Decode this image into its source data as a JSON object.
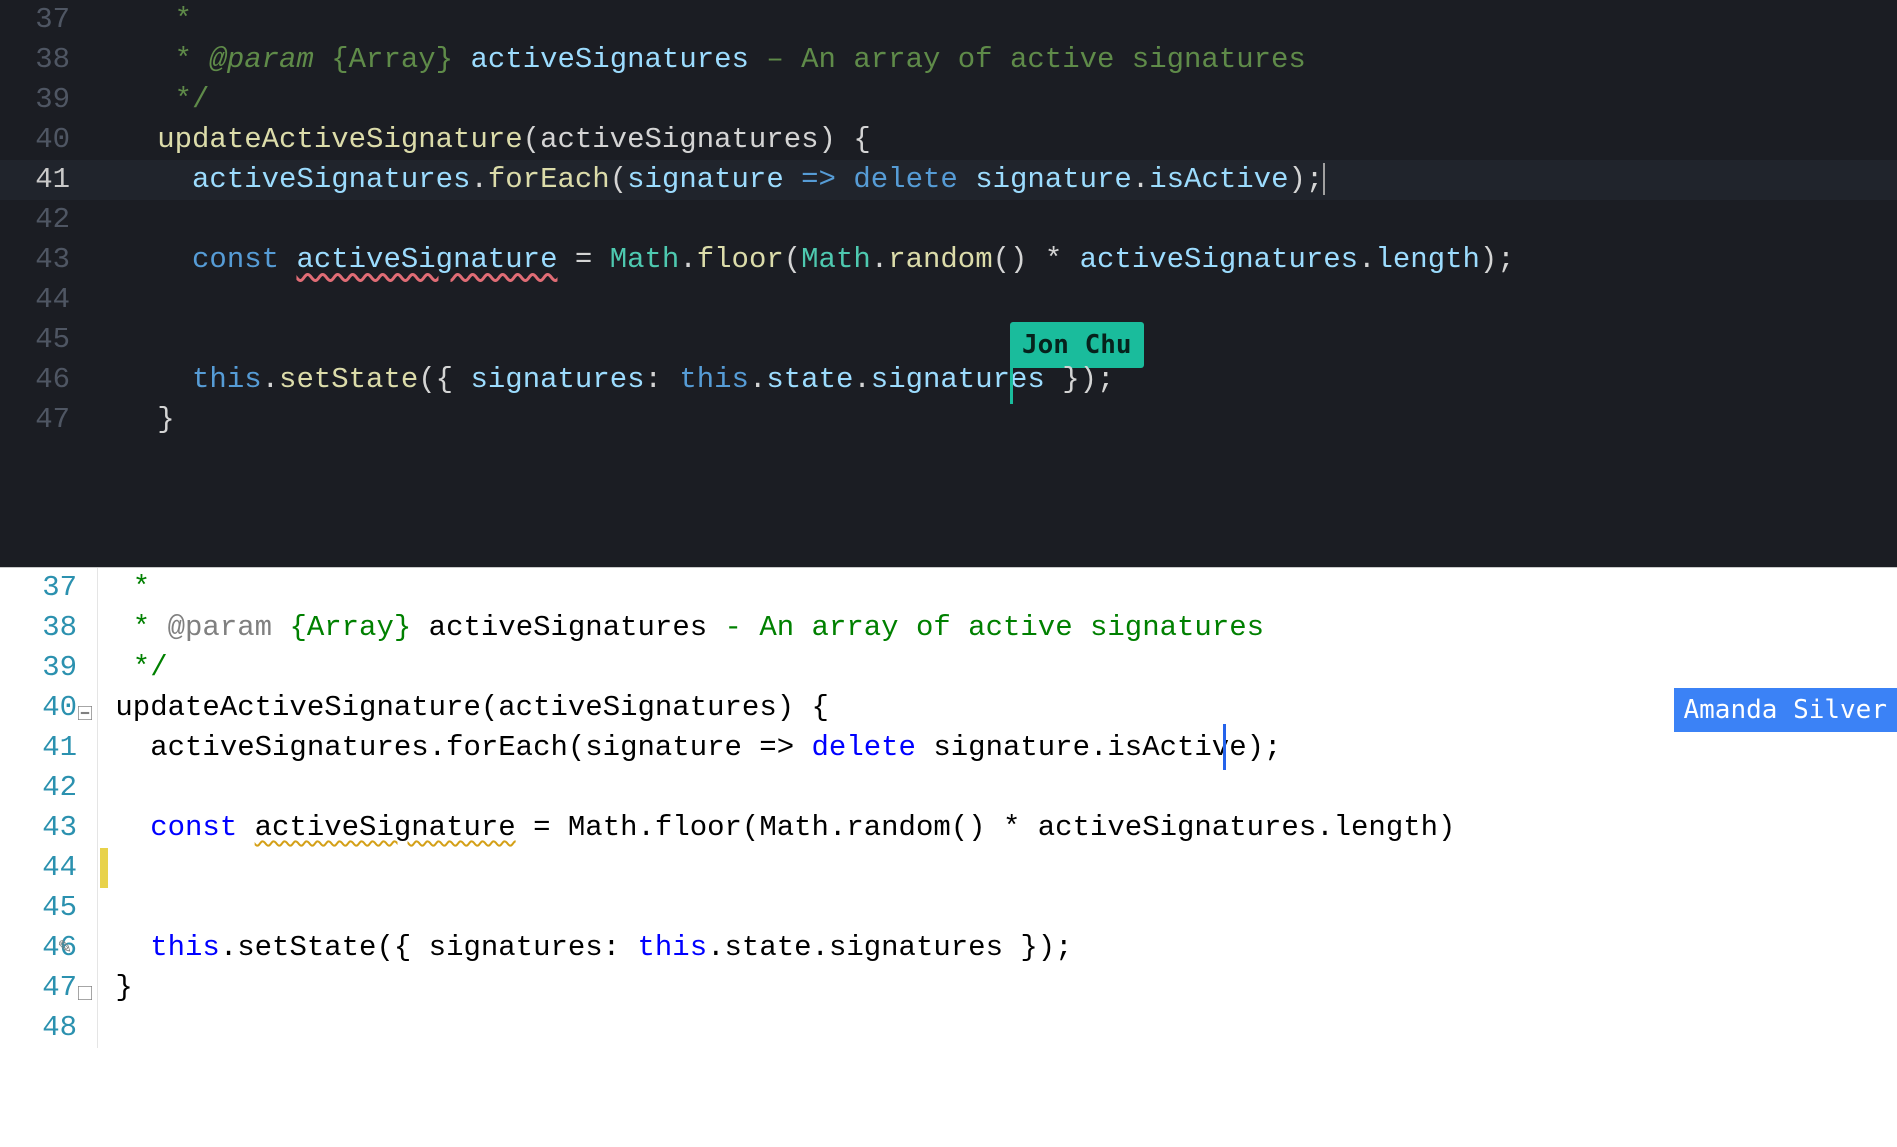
{
  "dark": {
    "gutter": [
      "37",
      "38",
      "39",
      "40",
      "41",
      "42",
      "43",
      "44",
      "45",
      "46",
      "47"
    ],
    "collaborator": "Jon Chu",
    "lines": {
      "l37": "   *",
      "l38_prefix": "   * ",
      "l38_tag": "@param",
      "l38_type": " {Array}",
      "l38_var": " activeSignatures",
      "l38_desc": " – An array of active signatures",
      "l39": "   */",
      "l40_head": "  updateActiveSignature",
      "l40_args": "(activeSignatures) {",
      "l41_obj": "    activeSignatures",
      "l41_dot1": ".",
      "l41_forEach": "forEach",
      "l41_open": "(",
      "l41_param": "signature",
      "l41_arrow": " => ",
      "l41_delete": "delete",
      "l41_sp": " ",
      "l41_sig": "signature",
      "l41_dot2": ".",
      "l41_isActive": "isActive",
      "l41_end": ");",
      "l43_const": "    const ",
      "l43_var": "activeSignature",
      "l43_eq": " = ",
      "l43_math1": "Math",
      "l43_dot1": ".",
      "l43_floor": "floor",
      "l43_open": "(",
      "l43_math2": "Math",
      "l43_dot2": ".",
      "l43_random": "random",
      "l43_paren2": "() * ",
      "l43_sigs": "activeSignatures",
      "l43_dot3": ".",
      "l43_len": "length",
      "l43_end": ");",
      "l46_this": "    this",
      "l46_dot1": ".",
      "l46_setState": "setState",
      "l46_open": "({ ",
      "l46_key": "signatures",
      "l46_colon": ": ",
      "l46_this2": "this",
      "l46_dot2": ".",
      "l46_state": "state",
      "l46_dot3": ".",
      "l46_sigs": "signatures",
      "l46_end": " });",
      "l47": "  }"
    }
  },
  "light": {
    "gutter": [
      "37",
      "38",
      "39",
      "40",
      "41",
      "42",
      "43",
      "44",
      "45",
      "46",
      "47",
      "48"
    ],
    "collaborator": "Amanda Silver",
    "lines": {
      "l37": " *",
      "l38_prefix": " * ",
      "l38_tag": "@param",
      "l38_type": " {Array}",
      "l38_var": " activeSignatures",
      "l38_desc": " - An array of active signatures",
      "l39": " */",
      "l40_head": "updateActiveSignature",
      "l40_args": "(activeSignatures) {",
      "l41_obj": "  activeSignatures.forEach(signature => ",
      "l41_delete": "delete",
      "l41_rest": " signature.isActive);",
      "l43_const": "  const ",
      "l43_var": "activeSignature",
      "l43_rest": " = Math.floor(Math.random() * activeSignatures.length)",
      "l46_this": "  this",
      "l46_mid": ".setState({ signatures: ",
      "l46_this2": "this",
      "l46_rest": ".state.signatures });",
      "l47": "}"
    }
  }
}
